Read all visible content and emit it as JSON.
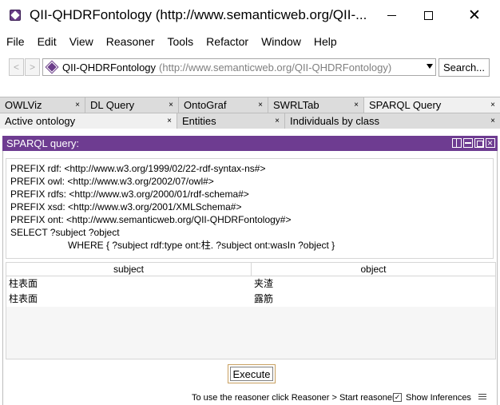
{
  "window": {
    "title": "QII-QHDRFontology (http://www.semanticweb.org/QII-...",
    "minimize_icon": "minimize-icon",
    "maximize_icon": "maximize-icon",
    "close_label": "✕"
  },
  "menu": [
    "File",
    "Edit",
    "View",
    "Reasoner",
    "Tools",
    "Refactor",
    "Window",
    "Help"
  ],
  "nav": {
    "back": "<",
    "forward": ">",
    "ontology_name": "QII-QHDRFontology",
    "ontology_iri": "(http://www.semanticweb.org/QII-QHDRFontology)",
    "search_label": "Search..."
  },
  "tabs_row1": [
    {
      "label": "OWLViz",
      "close": "×"
    },
    {
      "label": "DL Query",
      "close": "×"
    },
    {
      "label": "OntoGraf",
      "close": "×"
    },
    {
      "label": "SWRLTab",
      "close": "×"
    },
    {
      "label": "SPARQL Query",
      "close": "×",
      "active": true
    }
  ],
  "tabs_row2": [
    {
      "label": "Active ontology",
      "close": "×"
    },
    {
      "label": "Entities",
      "close": "×"
    },
    {
      "label": "Individuals by class",
      "close": "×"
    }
  ],
  "panel": {
    "title": "SPARQL query:",
    "accent": "#6e3c91"
  },
  "query": {
    "lines": [
      "PREFIX rdf: <http://www.w3.org/1999/02/22-rdf-syntax-ns#>",
      "PREFIX owl: <http://www.w3.org/2002/07/owl#>",
      "PREFIX rdfs: <http://www.w3.org/2000/01/rdf-schema#>",
      "PREFIX xsd: <http://www.w3.org/2001/XMLSchema#>",
      "PREFIX ont: <http://www.semanticweb.org/QII-QHDRFontology#>",
      "SELECT ?subject ?object"
    ],
    "where_line": "WHERE { ?subject rdf:type ont:柱. ?subject ont:wasIn ?object }"
  },
  "results": {
    "columns": [
      "subject",
      "object"
    ],
    "rows": [
      [
        "柱表面",
        "夹渣"
      ],
      [
        "柱表面",
        "露筋"
      ]
    ]
  },
  "execute_label": "Execute",
  "status": {
    "message": "To use the reasoner click Reasoner > Start reasoner",
    "show_inferences_label": "Show Inferences",
    "show_inferences_checked": true,
    "check_mark": "✓"
  }
}
